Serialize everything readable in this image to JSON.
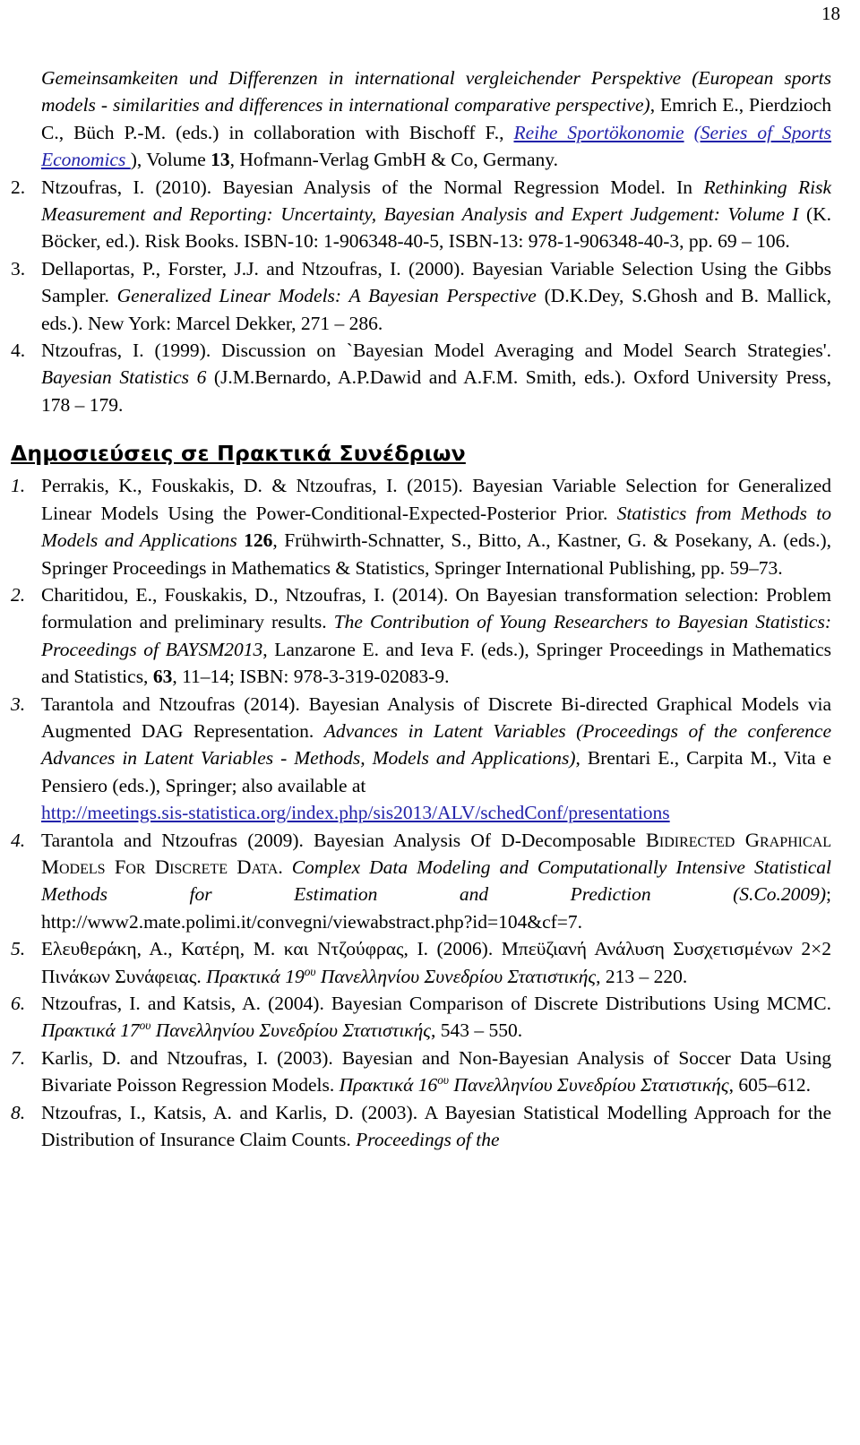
{
  "page": {
    "folio": "18"
  },
  "journal_tail": {
    "line1_italic": "Gemeinsamkeiten und Differenzen in international vergleichender Perspektive (European sports models - similarities and differences in international comparative perspective)",
    "after_italic": ", Emrich E., Pierdzioch C., Büch P.-M. (eds.) in collaboration with Bischoff F., ",
    "link1": "Reihe Sportökonomie",
    "link2": "(Series of Sports Economics ",
    "close_paren": "), Volume ",
    "volume": "13",
    "tail": ", Hofmann-Verlag GmbH & Co, Germany."
  },
  "book_chapters": [
    {
      "num": "2.",
      "segments": [
        {
          "text": "Ntzoufras, I. (2010). Bayesian Analysis of the Normal Regression Model. In ",
          "style": "normal"
        },
        {
          "text": "Rethinking Risk Measurement and Reporting: Uncertainty, Bayesian Analysis and Expert Judgement: Volume I",
          "style": "italic"
        },
        {
          "text": " (K. Böcker, ed.). Risk Books. ISBN-10: 1-906348-40-5, ISBN-13: 978-1-906348-40-3, pp. 69 – 106.",
          "style": "normal"
        }
      ]
    },
    {
      "num": "3.",
      "segments": [
        {
          "text": "Dellaportas, P., Forster, J.J. and Ntzoufras, I. (2000). Bayesian Variable Selection Using the Gibbs Sampler. ",
          "style": "normal"
        },
        {
          "text": "Generalized Linear Models: A Bayesian Perspective",
          "style": "italic"
        },
        {
          "text": " (D.K.Dey, S.Ghosh and B. Mallick, eds.). New York: Marcel Dekker, 271 – 286.",
          "style": "normal"
        }
      ]
    },
    {
      "num": "4.",
      "segments": [
        {
          "text": "Ntzoufras, I. (1999). Discussion on `Bayesian Model Averaging and Model Search Strategies'. ",
          "style": "normal"
        },
        {
          "text": "Bayesian Statistics 6",
          "style": "italic"
        },
        {
          "text": " (J.M.Bernardo, A.P.Dawid and A.F.M. Smith, eds.). Oxford University Press, 178 – 179.",
          "style": "normal"
        }
      ]
    }
  ],
  "section_heading": "Δημοσιεύσεις σε Πρακτικά Συνέδριων",
  "conference_papers": [
    {
      "num": "1.",
      "pre": "Perrakis, K.,  Fouskakis, D. & Ntzoufras, I. (2015). Bayesian Variable Selection for Generalized Linear Models Using the Power-Conditional-Expected-Posterior Prior. ",
      "title_italic": "Statistics from Methods to Models and Applications ",
      "bold_num": "126",
      "post": ", Frühwirth-Schnatter, S., Bitto, A.,  Kastner, G. & Posekany, A. (eds.), Springer Proceedings in Mathematics & Statistics, Springer International Publishing, pp. 59–73."
    },
    {
      "num": "2.",
      "pre": "Charitidou, E., Fouskakis, D., Ntzoufras, I. (2014).  On Bayesian transformation selection: Problem formulation and preliminary results.  ",
      "title_italic": "The Contribution of Young Researchers to Bayesian Statistics: Proceedings of BAYSM2013",
      "post": ", Lanzarone E. and Ieva F. (eds.), Springer Proceedings in Mathematics and Statistics, ",
      "bold_num": "63",
      "post2": ", 11–14; ISBN: 978-3-319-02083-9."
    },
    {
      "num": "3.",
      "pre": "Tarantola and Ntzoufras (2014). Bayesian Analysis of Discrete Bi-directed Graphical Models via Augmented DAG Representation. ",
      "title_italic": "Advances in Latent Variables (Proceedings of the conference Advances in Latent Variables - Methods, Models and Applications)",
      "post": ", Brentari E., Carpita M., Vita e Pensiero (eds.), Springer; also available at ",
      "url": "http://meetings.sis-statistica.org/index.php/sis2013/ALV/schedConf/presentations"
    },
    {
      "num": "4.",
      "pre": "Tarantola and Ntzoufras (2009). Bayesian Analysis Of D-Decomposable ",
      "smallcaps_line": "Bidirected Graphical Models For Discrete Data",
      "mid": ". ",
      "title_italic": "Complex Data Modeling and Computationally Intensive Statistical Methods for Estimation and Prediction (S.Co.2009)",
      "post": "; ",
      "url_plain": "http://www2.mate.polimi.it/convegni/viewabstract.php?id=104&cf=7."
    },
    {
      "num": "5.",
      "pre": "Ελευθεράκη, Α., Κατέρη, Μ.  και Ντζούφρας, Ι. (2006). Μπεϋζιανή Ανάλυση Συσχετισμένων  2×2 Πινάκων Συνάφειας. ",
      "title_italic_a": "Πρακτικά 19",
      "sup": "ου",
      "title_italic_b": " Πανελληνίου Συνεδρίου Στατιστικής",
      "post": ", 213 – 220."
    },
    {
      "num": "6.",
      "pre": "Ntzoufras, I. and Katsis, A. (2004). Bayesian Comparison of Discrete Distributions Using MCMC. ",
      "title_italic_a": "Πρακτικά 17",
      "sup": "ου",
      "title_italic_b": " Πανελληνίου Συνεδρίου Στατιστικής",
      "post": ", 543 – 550."
    },
    {
      "num": "7.",
      "pre": "Karlis, D. and Ntzoufras, I. (2003). Bayesian and Non-Bayesian Analysis of Soccer Data Using Bivariate Poisson Regression Models. ",
      "title_italic_a": "Πρακτικά 16",
      "sup": "ου",
      "title_italic_b": " Πανελληνίου Συνεδρίου Στατιστικής",
      "post": ", 605–612."
    },
    {
      "num": "8.",
      "pre": "Ntzoufras, I., Katsis, A. and Karlis, D. (2003). A Bayesian Statistical Modelling Approach for the Distribution of Insurance Claim Counts. ",
      "title_italic": "Proceedings of the"
    }
  ]
}
